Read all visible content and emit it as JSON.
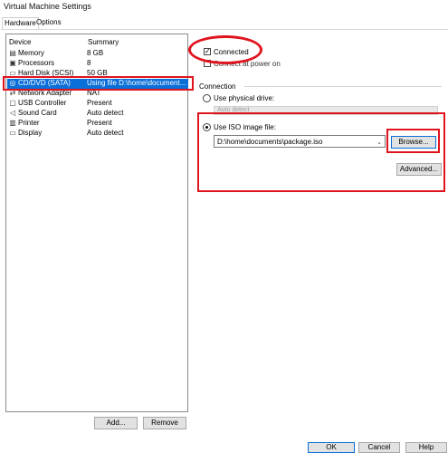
{
  "window": {
    "title": "Virtual Machine Settings"
  },
  "tabs": [
    {
      "label": "Hardware"
    },
    {
      "label": "Options"
    }
  ],
  "device_table": {
    "headers": {
      "device": "Device",
      "summary": "Summary"
    },
    "rows": [
      {
        "icon": "memory-icon",
        "name": "Memory",
        "summary": "8 GB"
      },
      {
        "icon": "processor-icon",
        "name": "Processors",
        "summary": "8"
      },
      {
        "icon": "hard-disk-icon",
        "name": "Hard Disk (SCSI)",
        "summary": "50 GB"
      },
      {
        "icon": "cd-dvd-icon",
        "name": "CD/DVD (SATA)",
        "summary": "Using file D:\\home\\document..."
      },
      {
        "icon": "network-adapter-icon",
        "name": "Network Adapter",
        "summary": "NAT"
      },
      {
        "icon": "usb-icon",
        "name": "USB Controller",
        "summary": "Present"
      },
      {
        "icon": "speaker-icon",
        "name": "Sound Card",
        "summary": "Auto detect"
      },
      {
        "icon": "printer-icon",
        "name": "Printer",
        "summary": "Present"
      },
      {
        "icon": "monitor-icon",
        "name": "Display",
        "summary": "Auto detect"
      }
    ],
    "selected_index": 3
  },
  "device_buttons": {
    "add": "Add...",
    "remove": "Remove"
  },
  "device_status": {
    "connected_label": "Connected",
    "connected_checked": true,
    "connect_at_power_on_label": "Connect at power on"
  },
  "connection": {
    "group_label": "Connection",
    "physical_drive_label": "Use physical drive:",
    "physical_drive_value": "Auto detect",
    "iso_label": "Use ISO image file:",
    "iso_value": "D:\\home\\documents\\package.iso",
    "selected": "iso",
    "browse_label": "Browse...",
    "advanced_label": "Advanced..."
  },
  "footer_buttons": {
    "ok": "OK",
    "cancel": "Cancel",
    "help": "Help"
  },
  "colors": {
    "selection": "#0a6fd8",
    "annotation_red": "#e0141e"
  }
}
